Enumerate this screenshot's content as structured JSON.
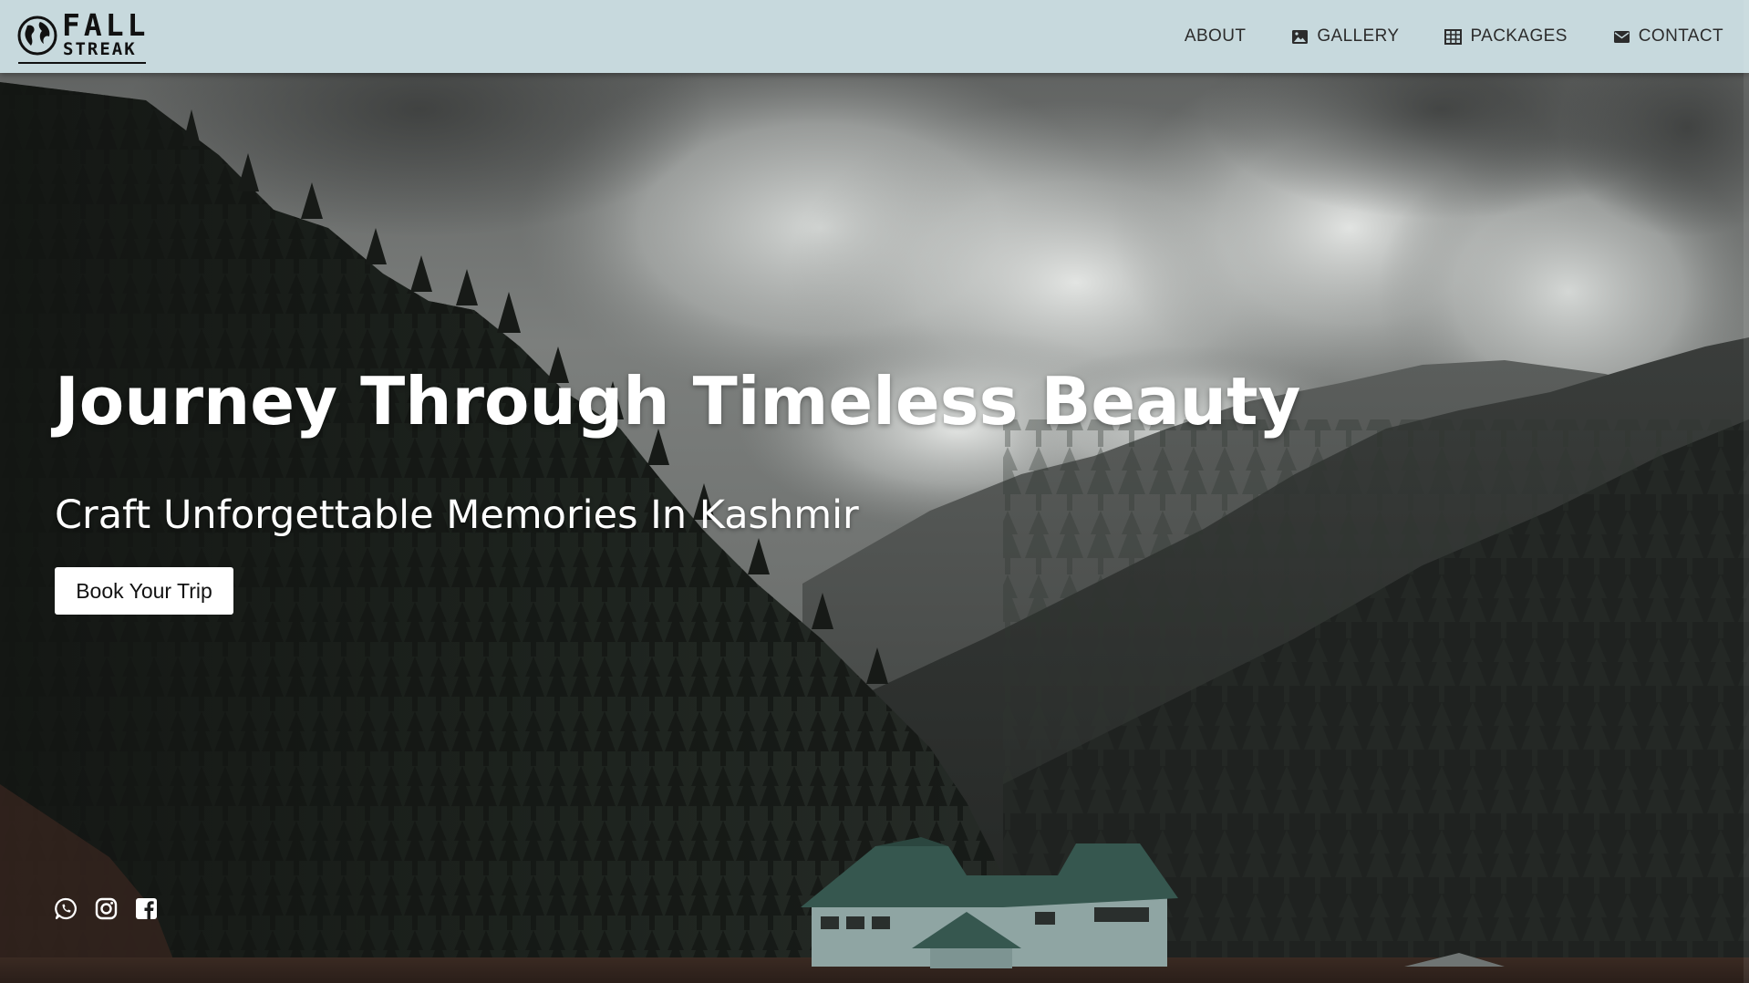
{
  "brand": {
    "line1": "FALL",
    "line2": "STREAK",
    "logo_icon": "globe-icon"
  },
  "nav": {
    "items": [
      {
        "label": "ABOUT",
        "icon": ""
      },
      {
        "label": "GALLERY",
        "icon": "image-icon"
      },
      {
        "label": "PACKAGES",
        "icon": "grid-icon"
      },
      {
        "label": "CONTACT",
        "icon": "envelope-icon"
      }
    ]
  },
  "hero": {
    "title": "Journey Through Timeless Beauty",
    "subtitle": "Craft Unforgettable Memories In Kashmir",
    "cta_label": "Book Your Trip"
  },
  "social": {
    "items": [
      {
        "icon": "whatsapp-icon"
      },
      {
        "icon": "instagram-icon"
      },
      {
        "icon": "facebook-icon"
      }
    ]
  },
  "colors": {
    "navbar_bg": "#c7d9dd",
    "nav_text": "#2c2c2c",
    "hero_text": "#ffffff",
    "cta_bg": "#ffffff"
  }
}
